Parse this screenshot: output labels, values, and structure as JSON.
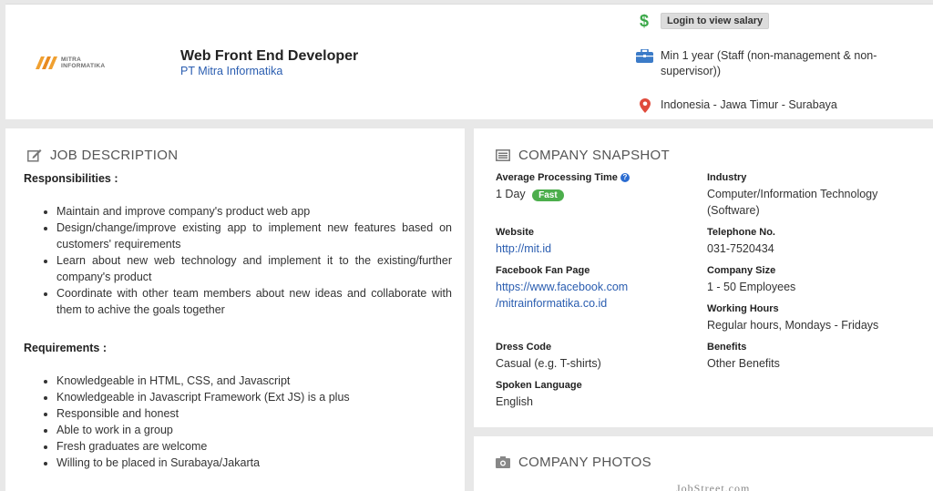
{
  "header": {
    "logo": {
      "line1": "MITRA",
      "line2": "INFORMATIKA",
      "mark_color": "#f0a030"
    },
    "job_title": "Web Front End Developer",
    "company_name": "PT Mitra Informatika",
    "salary_button": "Login to view salary",
    "experience": "Min 1 year (Staff (non-management & non-supervisor))",
    "location": "Indonesia - Jawa Timur - Surabaya",
    "icons": {
      "salary": "dollar-icon",
      "experience": "briefcase-icon",
      "location": "map-pin-icon"
    }
  },
  "job_description": {
    "heading": "JOB DESCRIPTION",
    "responsibilities_title": "Responsibilities :",
    "responsibilities": [
      "Maintain and improve company's product web app",
      "Design/change/improve existing app to implement new features based on customers' requirements",
      "Learn about new web technology and implement it to the existing/further company's product",
      "Coordinate with other team members about new ideas and collaborate with them to achive the goals together"
    ],
    "requirements_title": "Requirements :",
    "requirements": [
      "Knowledgeable in HTML, CSS, and Javascript",
      "Knowledgeable in Javascript Framework (Ext JS) is a plus",
      "Responsible and honest",
      "Able to work in a group",
      "Fresh graduates are welcome",
      "Willing to be placed in Surabaya/Jakarta"
    ]
  },
  "snapshot": {
    "heading": "COMPANY SNAPSHOT",
    "avg_processing_label": "Average Processing Time",
    "avg_processing_value": "1 Day",
    "avg_processing_badge": "Fast",
    "industry_label": "Industry",
    "industry_value": "Computer/Information Technology (Software)",
    "website_label": "Website",
    "website_value": "http://mit.id",
    "telephone_label": "Telephone No.",
    "telephone_value": "031-7520434",
    "facebook_label": "Facebook Fan Page",
    "facebook_line1": "https://www.facebook.com",
    "facebook_line2": "/mitrainformatika.co.id",
    "size_label": "Company Size",
    "size_value": "1 - 50 Employees",
    "hours_label": "Working Hours",
    "hours_value": "Regular hours, Mondays - Fridays",
    "dress_label": "Dress Code",
    "dress_value": "Casual (e.g. T-shirts)",
    "benefits_label": "Benefits",
    "benefits_value": "Other Benefits",
    "language_label": "Spoken Language",
    "language_value": "English"
  },
  "photos": {
    "heading": "COMPANY PHOTOS",
    "watermark": "JobStreet.com"
  },
  "colors": {
    "link": "#2a5db0",
    "salary_icon": "#3aa848",
    "briefcase_icon": "#3b7bc8",
    "pin_icon": "#e04b3c",
    "fast_badge": "#4cae4c"
  }
}
